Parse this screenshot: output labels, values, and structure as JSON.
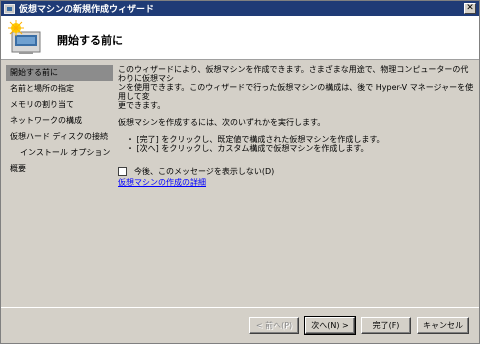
{
  "window": {
    "title": "仮想マシンの新規作成ウィザード",
    "close_glyph": "✕"
  },
  "header": {
    "title": "開始する前に"
  },
  "sidebar": {
    "items": [
      {
        "label": "開始する前に"
      },
      {
        "label": "名前と場所の指定"
      },
      {
        "label": "メモリの割り当て"
      },
      {
        "label": "ネットワークの構成"
      },
      {
        "label": "仮想ハード ディスクの接続"
      },
      {
        "label": "インストール オプション"
      },
      {
        "label": "概要"
      }
    ]
  },
  "content": {
    "intro_line1": "このウィザードにより、仮想マシンを作成できます。さまざまな用途で、物理コンピューターの代わりに仮想マシ",
    "intro_line2": "ンを使用できます。このウィザードで行った仮想マシンの構成は、後で Hyper-V マネージャーを使用して変",
    "intro_line3": "更できます。",
    "instruction": "仮想マシンを作成するには、次のいずれかを実行します。",
    "bullets": [
      "・ [完了] をクリックし、既定値で構成された仮想マシンを作成します。",
      "・ [次へ] をクリックし、カスタム構成で仮想マシンを作成します。"
    ],
    "checkbox_label": "今後、このメッセージを表示しない(D)",
    "checkbox_checked": false,
    "link": "仮想マシンの作成の詳細"
  },
  "buttons": {
    "back": "< 前へ(P)",
    "next": "次へ(N) >",
    "finish": "完了(F)",
    "cancel": "キャンセル"
  },
  "colors": {
    "titlebar": "#1f3b76",
    "active_nav": "#8c8c8c",
    "link": "#0000ff"
  }
}
